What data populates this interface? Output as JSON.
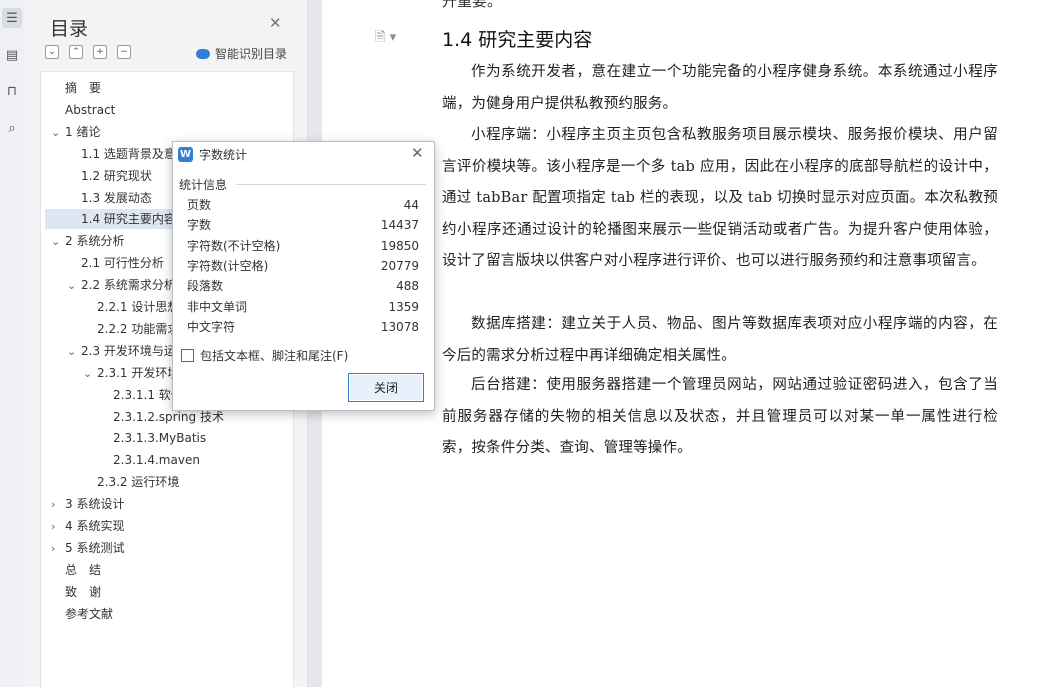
{
  "toc": {
    "title": "目录",
    "smart_label": "智能识别目录",
    "items": [
      {
        "label": "摘　要",
        "level": 0,
        "arrow": "",
        "selected": false
      },
      {
        "label": "Abstract",
        "level": 0,
        "arrow": "",
        "selected": false
      },
      {
        "label": "1 绪论",
        "level": 0,
        "arrow": "⌄",
        "selected": false
      },
      {
        "label": "1.1 选题背景及意",
        "level": 1,
        "arrow": "",
        "selected": false
      },
      {
        "label": "1.2 研究现状",
        "level": 1,
        "arrow": "",
        "selected": false
      },
      {
        "label": "1.3 发展动态",
        "level": 1,
        "arrow": "",
        "selected": false
      },
      {
        "label": "1.4 研究主要内容",
        "level": 1,
        "arrow": "",
        "selected": true
      },
      {
        "label": "2 系统分析",
        "level": 0,
        "arrow": "⌄",
        "selected": false
      },
      {
        "label": "2.1 可行性分析",
        "level": 1,
        "arrow": "",
        "selected": false
      },
      {
        "label": "2.2 系统需求分析",
        "level": 1,
        "arrow": "⌄",
        "selected": false
      },
      {
        "label": "2.2.1 设计思想",
        "level": 2,
        "arrow": "",
        "selected": false
      },
      {
        "label": "2.2.2 功能需求",
        "level": 2,
        "arrow": "",
        "selected": false
      },
      {
        "label": "2.3 开发环境与运",
        "level": 1,
        "arrow": "⌄",
        "selected": false
      },
      {
        "label": "2.3.1 开发环境",
        "level": 2,
        "arrow": "⌄",
        "selected": false
      },
      {
        "label": "2.3.1.1 软件",
        "level": 3,
        "arrow": "",
        "selected": false
      },
      {
        "label": "2.3.1.2.spring 技术",
        "level": 3,
        "arrow": "",
        "selected": false
      },
      {
        "label": "2.3.1.3.MyBatis",
        "level": 3,
        "arrow": "",
        "selected": false
      },
      {
        "label": "2.3.1.4.maven",
        "level": 3,
        "arrow": "",
        "selected": false
      },
      {
        "label": "2.3.2 运行环境",
        "level": 2,
        "arrow": "",
        "selected": false
      },
      {
        "label": "3 系统设计",
        "level": 0,
        "arrow": "›",
        "selected": false
      },
      {
        "label": "4 系统实现",
        "level": 0,
        "arrow": "›",
        "selected": false
      },
      {
        "label": "5 系统测试",
        "level": 0,
        "arrow": "›",
        "selected": false
      },
      {
        "label": "总　结",
        "level": 0,
        "arrow": "",
        "selected": false
      },
      {
        "label": "致　谢",
        "level": 0,
        "arrow": "",
        "selected": false
      },
      {
        "label": "参考文献",
        "level": 0,
        "arrow": "",
        "selected": false
      }
    ]
  },
  "doc": {
    "top_cut": "升重要。",
    "heading": "1.4 研究主要内容",
    "paragraphs": [
      "作为系统开发者，意在建立一个功能完备的小程序健身系统。本系统通过小程序端，为健身用户提供私教预约服务。",
      "小程序端：小程序主页主页包含私教服务项目展示模块、服务报价模块、用户留言评价模块等。该小程序是一个多 tab 应用，因此在小程序的底部导航栏的设计中，通过 tabBar 配置项指定 tab 栏的表现，以及 tab 切换时显示对应页面。本次私教预约小程序还通过设计的轮播图来展示一些促销活动或者广告。为提升客户使用体验，设计了留言版块以供客户对小程序进行评价、也可以进行服务预约和注意事项留言。",
      "数据库搭建：建立关于人员、物品、图片等数据库表项对应小程序端的内容，在今后的需求分析过程中再详细确定相关属性。",
      "后台搭建：使用服务器搭建一个管理员网站，网站通过验证密码进入，包含了当前服务器存储的失物的相关信息以及状态，并且管理员可以对某一单一属性进行检索，按条件分类、查询、管理等操作。"
    ]
  },
  "dialog": {
    "title": "字数统计",
    "group_label": "统计信息",
    "stats": [
      {
        "label": "页数",
        "value": "44"
      },
      {
        "label": "字数",
        "value": "14437"
      },
      {
        "label": "字符数(不计空格)",
        "value": "19850"
      },
      {
        "label": "字符数(计空格)",
        "value": "20779"
      },
      {
        "label": "段落数",
        "value": "488"
      },
      {
        "label": "非中文单词",
        "value": "1359"
      },
      {
        "label": "中文字符",
        "value": "13078"
      }
    ],
    "checkbox_label": "包括文本框、脚注和尾注(F)",
    "close_label": "关闭"
  },
  "colors": {
    "accent": "#2f7fd6",
    "selected_bg": "#dfe6f3"
  }
}
